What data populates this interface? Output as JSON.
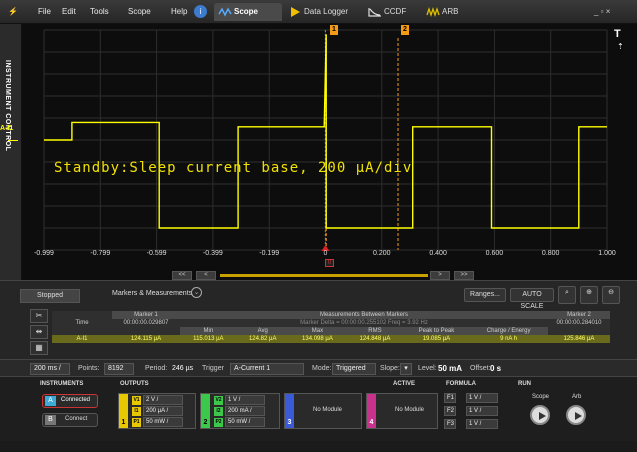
{
  "menu": [
    "File",
    "Edit",
    "Tools",
    "Scope",
    "Help"
  ],
  "tabs": [
    {
      "label": "Scope",
      "active": true
    },
    {
      "label": "Data Logger",
      "active": false
    },
    {
      "label": "CCDF",
      "active": false
    },
    {
      "label": "ARB",
      "active": false
    }
  ],
  "window_controls": "_ ▫ ×",
  "instrument_control_label": "INSTRUMENT CONTROL",
  "channel_label": "A-I1",
  "overlay_text": "Standby:Sleep current base, 200 µA/div",
  "plot_side": {
    "t_label": "T"
  },
  "markers": [
    {
      "label": "1"
    },
    {
      "label": "2"
    }
  ],
  "zero_marker": "0",
  "chart_data": {
    "type": "line",
    "x_ticks": [
      "-0.999",
      "-0.799",
      "-0.599",
      "-0.399",
      "-0.199",
      "0",
      "0.200",
      "0.400",
      "0.600",
      "0.800",
      "1.000"
    ],
    "xlim": [
      -0.999,
      1.0
    ],
    "ylim": [
      -1.0,
      1.0
    ],
    "grid": true,
    "series": [
      {
        "name": "A-I1",
        "color": "#ffff00",
        "x": [
          -0.999,
          -0.9,
          -0.9,
          -0.59,
          -0.59,
          -0.31,
          -0.31,
          -0.004,
          0.003,
          0.003,
          0.01,
          0.31,
          0.31,
          0.59,
          0.59,
          0.9,
          0.9,
          1.0
        ],
        "y": [
          0.0,
          0.0,
          0.16,
          0.16,
          -0.8,
          -0.8,
          0.12,
          0.12,
          0.96,
          -0.8,
          -0.8,
          -0.8,
          0.12,
          0.12,
          -0.8,
          -0.8,
          0.12,
          0.12
        ]
      }
    ]
  },
  "scroll": {
    "left_far": "<<",
    "left": "<",
    "right": ">",
    "right_far": ">>"
  },
  "measurements": {
    "status": "Stopped",
    "panel_title": "Markers & Measurements",
    "ranges_btn": "Ranges...",
    "autoscale_btn": "AUTO SCALE",
    "marker1_head": "Marker 1",
    "marker1_time": "00:00:00.029807",
    "between_head": "Measurements Between Markers",
    "between_sub": "Marker Delta = 00:00:00.255102   Freq = 3.92 Hz",
    "marker2_head": "Marker 2",
    "marker2_time": "00:00:00.284010",
    "time_label": "Time",
    "columns": [
      "Min",
      "Avg",
      "Max",
      "RMS",
      "Peak to Peak",
      "Charge / Energy"
    ],
    "row_label": "A-I1",
    "marker1_value": "124.115 µA",
    "values": [
      "115.013 µA",
      "124.82 µA",
      "134.098 µA",
      "124.848 µA",
      "19.085 µA",
      "9 nA h"
    ],
    "marker2_value": "125.846 µA"
  },
  "controls": {
    "timebase": "200 ms /",
    "points_label": "Points:",
    "points": "8192",
    "period_label": "Period:",
    "period": "246 µs",
    "trigger_label": "Trigger",
    "trigger": "A-Current 1",
    "mode_label": "Mode:",
    "mode": "Triggered",
    "slope_label": "Slope:",
    "level_label": "Level:",
    "level": "50 mA",
    "offset_label": "Offset:",
    "offset": "0 s"
  },
  "bottom": {
    "instruments_title": "INSTRUMENTS",
    "outputs_title": "OUTPUTS",
    "active_title": "ACTIVE",
    "formula_title": "FORMULA",
    "run_title": "RUN",
    "inst_a": "A",
    "inst_a_label": "Connected",
    "inst_b": "B",
    "inst_b_label": "Connect",
    "ch1": {
      "num": "1",
      "v": "2 V /",
      "i": "200 µA /",
      "p": "50 mW /"
    },
    "ch2": {
      "num": "2",
      "v": "1 V /",
      "i": "200 mA /",
      "p": "50 mW /"
    },
    "ch3": {
      "num": "3",
      "label": "No Module"
    },
    "ch4": {
      "num": "4",
      "label": "No Module"
    },
    "formulas": [
      {
        "f": "F1",
        "v": "1 V /"
      },
      {
        "f": "F2",
        "v": "1 V /"
      },
      {
        "f": "F3",
        "v": "1 V /"
      }
    ],
    "run_scope": "Scope",
    "run_arb": "Arb",
    "tags": {
      "v": "V1",
      "i": "I1",
      "p": "P1",
      "v2": "V2",
      "i2": "I2",
      "p2": "P2"
    }
  }
}
